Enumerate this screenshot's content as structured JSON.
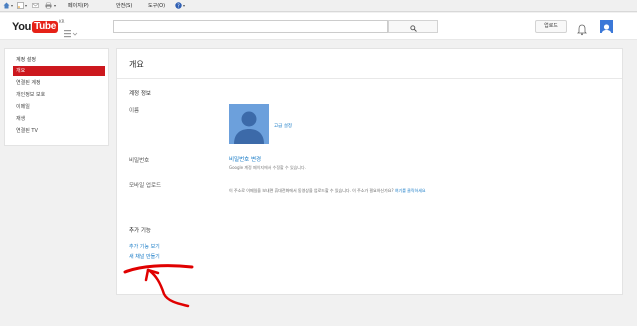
{
  "ie_bar": {
    "page_menu": "페이지(P)",
    "safety_menu": "안전(S)",
    "tools_menu": "도구(O)"
  },
  "header": {
    "logo_you": "You",
    "logo_tube": "Tube",
    "logo_region": "KR",
    "search_placeholder": "",
    "upload_label": "업로드"
  },
  "sidebar": {
    "title": "계정 설정",
    "items": [
      {
        "label": "개요",
        "active": true
      },
      {
        "label": "연결된 계정",
        "active": false
      },
      {
        "label": "개인정보 보호",
        "active": false
      },
      {
        "label": "이메일",
        "active": false
      },
      {
        "label": "재생",
        "active": false
      },
      {
        "label": "연결된 TV",
        "active": false
      }
    ]
  },
  "main": {
    "title": "개요",
    "account_info_heading": "계정 정보",
    "name_label": "이름",
    "advanced_link": "고급 설정",
    "password_label": "비밀번호",
    "password_link": "비밀번호 변경",
    "password_note": "Google 계정 페이지에서 수정할 수 있습니다.",
    "mobile_label": "모바일 업로드",
    "mobile_desc": "이 주소로 이메일을 보내면 휴대전화에서 동영상을 업로드할 수 있습니다. 이 주소가 필요하신가요?",
    "mobile_desc_link": "여기를 클릭하세요",
    "extras_heading": "추가 기능",
    "extra_links": [
      "추가 기능 보기",
      "새 채널 만들기"
    ]
  },
  "colors": {
    "accent_red": "#cc181e",
    "link_blue": "#167ac6",
    "annotation_red": "#e00000"
  }
}
